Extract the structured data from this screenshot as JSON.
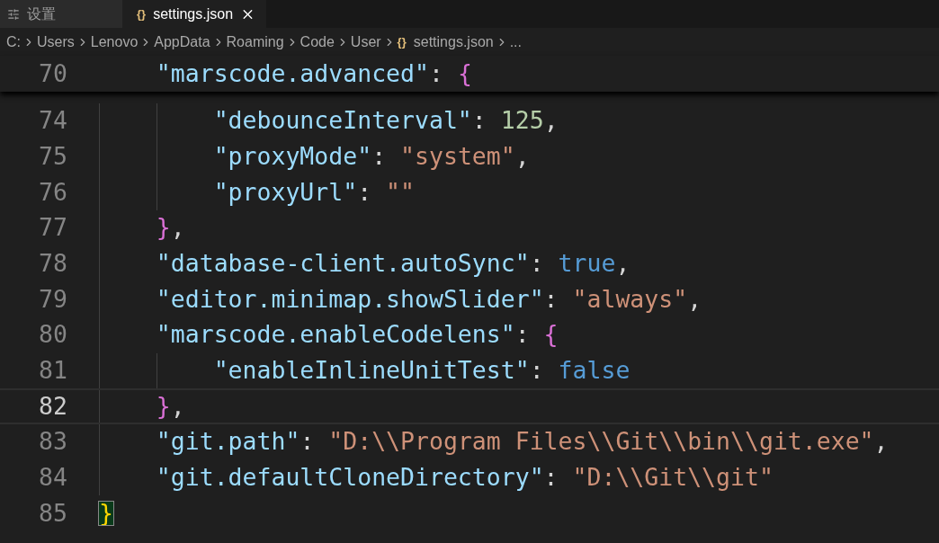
{
  "tabs": [
    {
      "label": "设置",
      "kind": "settings",
      "selected": false
    },
    {
      "label": "settings.json",
      "kind": "json",
      "icon": "{}",
      "selected": true
    }
  ],
  "breadcrumb": {
    "segments": [
      {
        "label": "C:"
      },
      {
        "label": "Users"
      },
      {
        "label": "Lenovo"
      },
      {
        "label": "AppData"
      },
      {
        "label": "Roaming"
      },
      {
        "label": "Code"
      },
      {
        "label": "User"
      },
      {
        "label": "settings.json",
        "icon": "{}"
      },
      {
        "label": "..."
      }
    ]
  },
  "sticky_line": {
    "number": "70",
    "tokens": [
      {
        "kind": "key",
        "text": "    \"marscode.advanced\""
      },
      {
        "kind": "punct",
        "text": ": "
      },
      {
        "kind": "bracket",
        "text": "{",
        "color": "#da70d6"
      }
    ]
  },
  "lines": [
    {
      "number": "74",
      "current": false,
      "bracket_match": false,
      "tokens": [
        {
          "kind": "key",
          "text": "        \"debounceInterval\""
        },
        {
          "kind": "punct",
          "text": ": "
        },
        {
          "kind": "number",
          "text": "125"
        },
        {
          "kind": "punct",
          "text": ","
        }
      ]
    },
    {
      "number": "75",
      "current": false,
      "bracket_match": false,
      "tokens": [
        {
          "kind": "key",
          "text": "        \"proxyMode\""
        },
        {
          "kind": "punct",
          "text": ": "
        },
        {
          "kind": "string",
          "text": "\"system\""
        },
        {
          "kind": "punct",
          "text": ","
        }
      ]
    },
    {
      "number": "76",
      "current": false,
      "bracket_match": false,
      "tokens": [
        {
          "kind": "key",
          "text": "        \"proxyUrl\""
        },
        {
          "kind": "punct",
          "text": ": "
        },
        {
          "kind": "string",
          "text": "\"\""
        }
      ]
    },
    {
      "number": "77",
      "current": false,
      "bracket_match": false,
      "tokens": [
        {
          "kind": "bracket",
          "text": "    }",
          "color": "#da70d6"
        },
        {
          "kind": "punct",
          "text": ","
        }
      ]
    },
    {
      "number": "78",
      "current": false,
      "bracket_match": false,
      "tokens": [
        {
          "kind": "key",
          "text": "    \"database-client.autoSync\""
        },
        {
          "kind": "punct",
          "text": ": "
        },
        {
          "kind": "keyword",
          "text": "true"
        },
        {
          "kind": "punct",
          "text": ","
        }
      ]
    },
    {
      "number": "79",
      "current": false,
      "bracket_match": false,
      "tokens": [
        {
          "kind": "key",
          "text": "    \"editor.minimap.showSlider\""
        },
        {
          "kind": "punct",
          "text": ": "
        },
        {
          "kind": "string",
          "text": "\"always\""
        },
        {
          "kind": "punct",
          "text": ","
        }
      ]
    },
    {
      "number": "80",
      "current": false,
      "bracket_match": false,
      "tokens": [
        {
          "kind": "key",
          "text": "    \"marscode.enableCodelens\""
        },
        {
          "kind": "punct",
          "text": ": "
        },
        {
          "kind": "bracket",
          "text": "{",
          "color": "#da70d6"
        }
      ]
    },
    {
      "number": "81",
      "current": false,
      "bracket_match": false,
      "tokens": [
        {
          "kind": "key",
          "text": "        \"enableInlineUnitTest\""
        },
        {
          "kind": "punct",
          "text": ": "
        },
        {
          "kind": "keyword",
          "text": "false"
        }
      ]
    },
    {
      "number": "82",
      "current": true,
      "bracket_match": false,
      "tokens": [
        {
          "kind": "bracket",
          "text": "    }",
          "color": "#da70d6"
        },
        {
          "kind": "punct",
          "text": ","
        }
      ]
    },
    {
      "number": "83",
      "current": false,
      "bracket_match": false,
      "tokens": [
        {
          "kind": "key",
          "text": "    \"git.path\""
        },
        {
          "kind": "punct",
          "text": ": "
        },
        {
          "kind": "string",
          "text": "\"D:\\\\Program Files\\\\Git\\\\bin\\\\git.exe\""
        },
        {
          "kind": "punct",
          "text": ","
        }
      ]
    },
    {
      "number": "84",
      "current": false,
      "bracket_match": false,
      "tokens": [
        {
          "kind": "key",
          "text": "    \"git.defaultCloneDirectory\""
        },
        {
          "kind": "punct",
          "text": ": "
        },
        {
          "kind": "string",
          "text": "\"D:\\\\Git\\\\git\""
        }
      ]
    },
    {
      "number": "85",
      "current": false,
      "bracket_match": true,
      "tokens": [
        {
          "kind": "bracket",
          "text": "}",
          "color": "#ffd700"
        }
      ]
    }
  ]
}
